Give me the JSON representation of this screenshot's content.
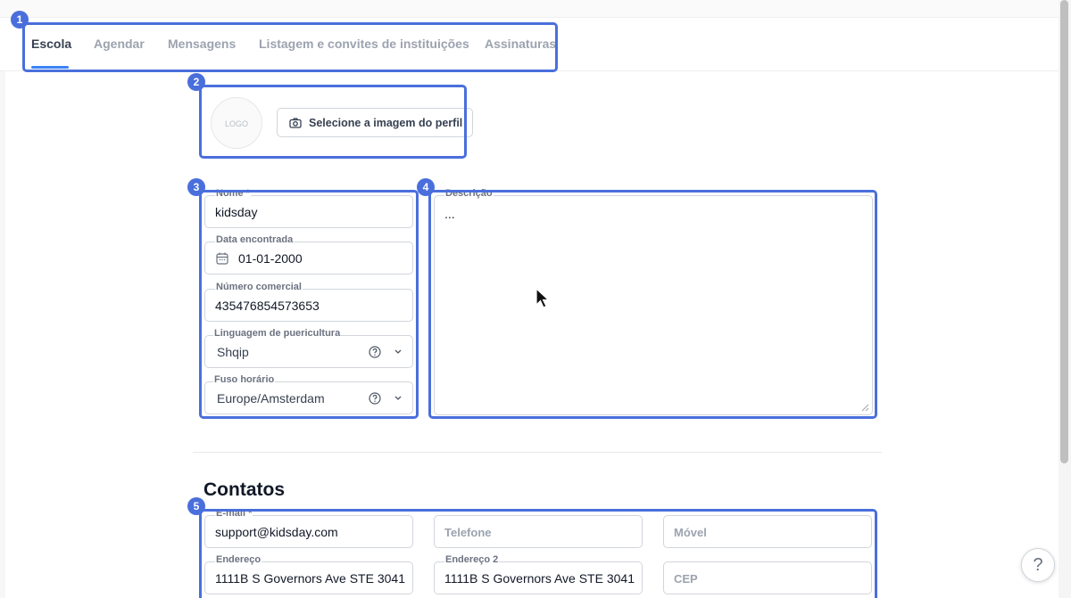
{
  "tabs": [
    {
      "label": "Escola",
      "active": true
    },
    {
      "label": "Agendar",
      "active": false
    },
    {
      "label": "Mensagens",
      "active": false
    },
    {
      "label": "Listagem e convites de instituições",
      "active": false
    },
    {
      "label": "Assinaturas",
      "active": false
    }
  ],
  "annotations": [
    "1",
    "2",
    "3",
    "4",
    "5"
  ],
  "profile": {
    "logo_text": "LOGO",
    "select_image_label": "Selecione a imagem do perfil",
    "icon": "camera-icon"
  },
  "form": {
    "name": {
      "label": "Nome *",
      "value": "kidsday"
    },
    "founded": {
      "label": "Data encontrada",
      "value": "01-01-2000",
      "icon": "calendar-icon"
    },
    "business_number": {
      "label": "Número comercial",
      "value": "435476854573653"
    },
    "language": {
      "label": "Linguagem de puericultura",
      "value": "Shqip"
    },
    "timezone": {
      "label": "Fuso horário",
      "value": "Europe/Amsterdam"
    },
    "description": {
      "label": "Descrição",
      "value": "..."
    }
  },
  "contacts": {
    "title": "Contatos",
    "email": {
      "label": "E-mail *",
      "value": "support@kidsday.com"
    },
    "phone": {
      "placeholder": "Telefone"
    },
    "mobile": {
      "placeholder": "Móvel"
    },
    "address": {
      "label": "Endereço",
      "value": "1111B S Governors Ave STE 3041,,"
    },
    "address2": {
      "label": "Endereço 2",
      "value": "1111B S Governors Ave STE 3041,,"
    },
    "zip": {
      "placeholder": "CEP"
    }
  },
  "help": {
    "label": "?"
  },
  "colors": {
    "accent": "#4a6fdc",
    "tab_underline": "#3b82f6"
  }
}
